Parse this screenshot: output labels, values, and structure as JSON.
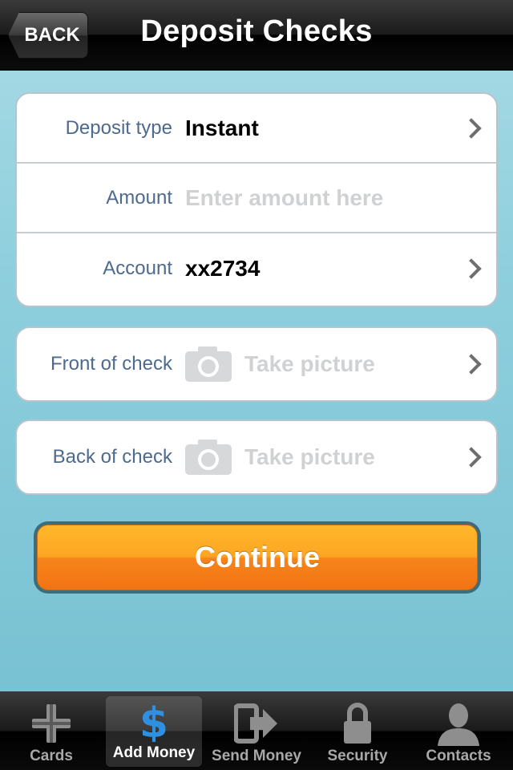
{
  "navbar": {
    "back_label": "BACK",
    "title": "Deposit Checks"
  },
  "form": {
    "deposit_type": {
      "label": "Deposit type",
      "value": "Instant"
    },
    "amount": {
      "label": "Amount",
      "placeholder": "Enter amount here"
    },
    "account": {
      "label": "Account",
      "value": "xx2734"
    }
  },
  "photos": {
    "front": {
      "label": "Front of check",
      "action": "Take picture"
    },
    "back": {
      "label": "Back of check",
      "action": "Take picture"
    }
  },
  "continue_label": "Continue",
  "tabs": [
    {
      "label": "Cards",
      "icon": "cards-icon",
      "active": false
    },
    {
      "label": "Add Money",
      "icon": "dollar-icon",
      "active": true
    },
    {
      "label": "Send Money",
      "icon": "send-money-icon",
      "active": false
    },
    {
      "label": "Security",
      "icon": "lock-icon",
      "active": false
    },
    {
      "label": "Contacts",
      "icon": "person-icon",
      "active": false
    }
  ],
  "colors": {
    "accent": "#f7841a",
    "label": "#4d6a8e",
    "active_tab_icon": "#2f8fe0"
  }
}
